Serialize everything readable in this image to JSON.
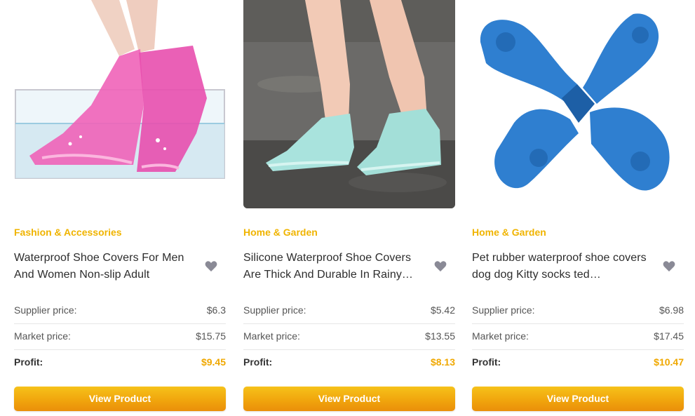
{
  "accent_color": "#f0b400",
  "products": [
    {
      "category": "Fashion & Accessories",
      "title": "Waterproof Shoe Covers For Men And Women Non-slip Adult",
      "supplier_label": "Supplier price:",
      "supplier_price": "$6.3",
      "market_label": "Market price:",
      "market_price": "$15.75",
      "profit_label": "Profit:",
      "profit": "$9.45",
      "button": "View Product",
      "image_icon": "pink-shoe-covers-image"
    },
    {
      "category": "Home & Garden",
      "title": "Silicone Waterproof Shoe Covers Are Thick And Durable In Rainy…",
      "supplier_label": "Supplier price:",
      "supplier_price": "$5.42",
      "market_label": "Market price:",
      "market_price": "$13.55",
      "profit_label": "Profit:",
      "profit": "$8.13",
      "button": "View Product",
      "image_icon": "mint-silicone-covers-image"
    },
    {
      "category": "Home & Garden",
      "title": "Pet rubber waterproof shoe covers dog dog Kitty socks ted…",
      "supplier_label": "Supplier price:",
      "supplier_price": "$6.98",
      "market_label": "Market price:",
      "market_price": "$17.45",
      "profit_label": "Profit:",
      "profit": "$10.47",
      "button": "View Product",
      "image_icon": "blue-pet-boots-image"
    }
  ]
}
